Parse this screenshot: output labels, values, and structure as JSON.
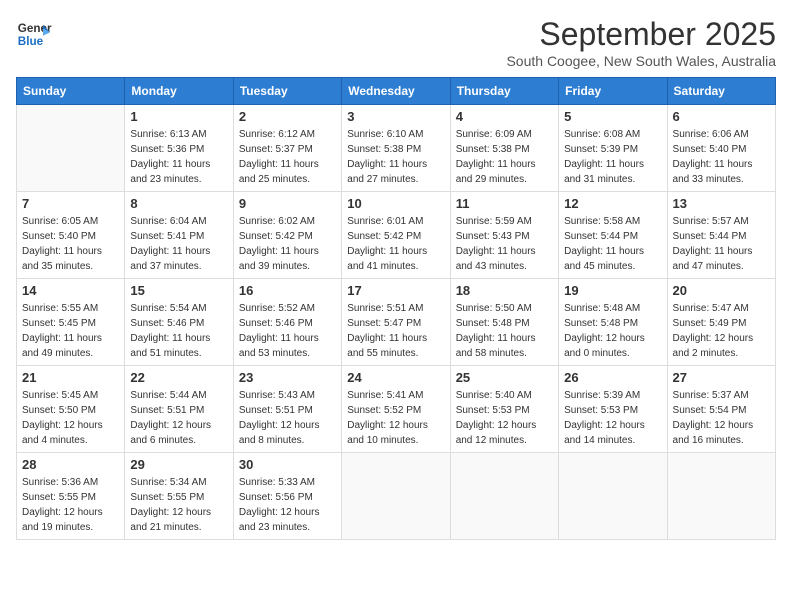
{
  "logo": {
    "line1": "General",
    "line2": "Blue"
  },
  "title": "September 2025",
  "subtitle": "South Coogee, New South Wales, Australia",
  "weekdays": [
    "Sunday",
    "Monday",
    "Tuesday",
    "Wednesday",
    "Thursday",
    "Friday",
    "Saturday"
  ],
  "weeks": [
    [
      {
        "day": "",
        "info": ""
      },
      {
        "day": "1",
        "info": "Sunrise: 6:13 AM\nSunset: 5:36 PM\nDaylight: 11 hours\nand 23 minutes."
      },
      {
        "day": "2",
        "info": "Sunrise: 6:12 AM\nSunset: 5:37 PM\nDaylight: 11 hours\nand 25 minutes."
      },
      {
        "day": "3",
        "info": "Sunrise: 6:10 AM\nSunset: 5:38 PM\nDaylight: 11 hours\nand 27 minutes."
      },
      {
        "day": "4",
        "info": "Sunrise: 6:09 AM\nSunset: 5:38 PM\nDaylight: 11 hours\nand 29 minutes."
      },
      {
        "day": "5",
        "info": "Sunrise: 6:08 AM\nSunset: 5:39 PM\nDaylight: 11 hours\nand 31 minutes."
      },
      {
        "day": "6",
        "info": "Sunrise: 6:06 AM\nSunset: 5:40 PM\nDaylight: 11 hours\nand 33 minutes."
      }
    ],
    [
      {
        "day": "7",
        "info": "Sunrise: 6:05 AM\nSunset: 5:40 PM\nDaylight: 11 hours\nand 35 minutes."
      },
      {
        "day": "8",
        "info": "Sunrise: 6:04 AM\nSunset: 5:41 PM\nDaylight: 11 hours\nand 37 minutes."
      },
      {
        "day": "9",
        "info": "Sunrise: 6:02 AM\nSunset: 5:42 PM\nDaylight: 11 hours\nand 39 minutes."
      },
      {
        "day": "10",
        "info": "Sunrise: 6:01 AM\nSunset: 5:42 PM\nDaylight: 11 hours\nand 41 minutes."
      },
      {
        "day": "11",
        "info": "Sunrise: 5:59 AM\nSunset: 5:43 PM\nDaylight: 11 hours\nand 43 minutes."
      },
      {
        "day": "12",
        "info": "Sunrise: 5:58 AM\nSunset: 5:44 PM\nDaylight: 11 hours\nand 45 minutes."
      },
      {
        "day": "13",
        "info": "Sunrise: 5:57 AM\nSunset: 5:44 PM\nDaylight: 11 hours\nand 47 minutes."
      }
    ],
    [
      {
        "day": "14",
        "info": "Sunrise: 5:55 AM\nSunset: 5:45 PM\nDaylight: 11 hours\nand 49 minutes."
      },
      {
        "day": "15",
        "info": "Sunrise: 5:54 AM\nSunset: 5:46 PM\nDaylight: 11 hours\nand 51 minutes."
      },
      {
        "day": "16",
        "info": "Sunrise: 5:52 AM\nSunset: 5:46 PM\nDaylight: 11 hours\nand 53 minutes."
      },
      {
        "day": "17",
        "info": "Sunrise: 5:51 AM\nSunset: 5:47 PM\nDaylight: 11 hours\nand 55 minutes."
      },
      {
        "day": "18",
        "info": "Sunrise: 5:50 AM\nSunset: 5:48 PM\nDaylight: 11 hours\nand 58 minutes."
      },
      {
        "day": "19",
        "info": "Sunrise: 5:48 AM\nSunset: 5:48 PM\nDaylight: 12 hours\nand 0 minutes."
      },
      {
        "day": "20",
        "info": "Sunrise: 5:47 AM\nSunset: 5:49 PM\nDaylight: 12 hours\nand 2 minutes."
      }
    ],
    [
      {
        "day": "21",
        "info": "Sunrise: 5:45 AM\nSunset: 5:50 PM\nDaylight: 12 hours\nand 4 minutes."
      },
      {
        "day": "22",
        "info": "Sunrise: 5:44 AM\nSunset: 5:51 PM\nDaylight: 12 hours\nand 6 minutes."
      },
      {
        "day": "23",
        "info": "Sunrise: 5:43 AM\nSunset: 5:51 PM\nDaylight: 12 hours\nand 8 minutes."
      },
      {
        "day": "24",
        "info": "Sunrise: 5:41 AM\nSunset: 5:52 PM\nDaylight: 12 hours\nand 10 minutes."
      },
      {
        "day": "25",
        "info": "Sunrise: 5:40 AM\nSunset: 5:53 PM\nDaylight: 12 hours\nand 12 minutes."
      },
      {
        "day": "26",
        "info": "Sunrise: 5:39 AM\nSunset: 5:53 PM\nDaylight: 12 hours\nand 14 minutes."
      },
      {
        "day": "27",
        "info": "Sunrise: 5:37 AM\nSunset: 5:54 PM\nDaylight: 12 hours\nand 16 minutes."
      }
    ],
    [
      {
        "day": "28",
        "info": "Sunrise: 5:36 AM\nSunset: 5:55 PM\nDaylight: 12 hours\nand 19 minutes."
      },
      {
        "day": "29",
        "info": "Sunrise: 5:34 AM\nSunset: 5:55 PM\nDaylight: 12 hours\nand 21 minutes."
      },
      {
        "day": "30",
        "info": "Sunrise: 5:33 AM\nSunset: 5:56 PM\nDaylight: 12 hours\nand 23 minutes."
      },
      {
        "day": "",
        "info": ""
      },
      {
        "day": "",
        "info": ""
      },
      {
        "day": "",
        "info": ""
      },
      {
        "day": "",
        "info": ""
      }
    ]
  ]
}
